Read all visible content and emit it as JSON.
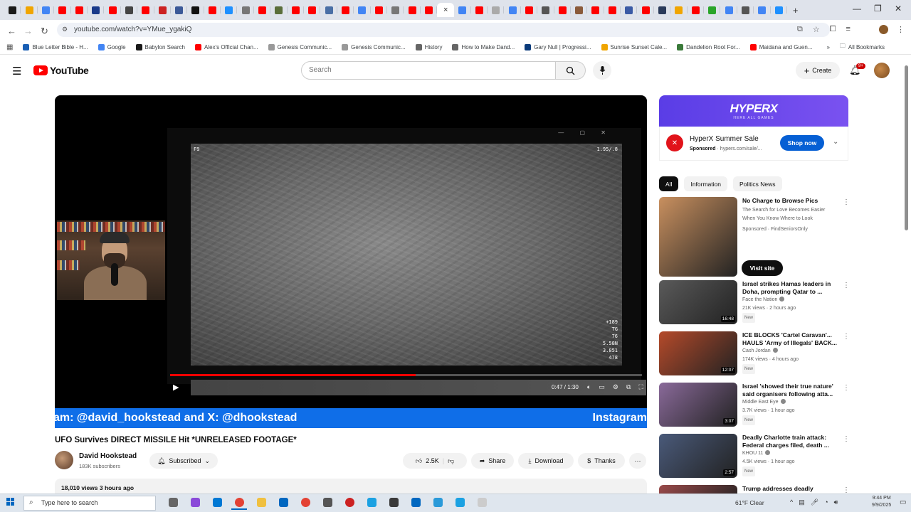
{
  "browser": {
    "tab_colors": [
      "#1a1a1a",
      "#f0a500",
      "#4285f4",
      "#ff0000",
      "#ff0000",
      "#1a3a8a",
      "#ff0000",
      "#444444",
      "#ff0000",
      "#cc2222",
      "#3b5998",
      "#111111",
      "#ff0000",
      "#1e90ff",
      "#777777",
      "#ff0000",
      "#5a6e3a",
      "#ff0000",
      "#ff0000",
      "#4a6fa5",
      "#ff0000",
      "#4285f4",
      "#ff0000",
      "#777777",
      "#ff0000",
      "#ff0000",
      "#ffffff",
      "#4285f4",
      "#ff0000",
      "#aaaaaa",
      "#4285f4",
      "#ff0000",
      "#555555",
      "#ff0000",
      "#8a5a3a",
      "#ff0000",
      "#ff0000",
      "#3a5aa5",
      "#ff0000",
      "#2a3a5a",
      "#f0a500",
      "#ff0000",
      "#2aa52a",
      "#4285f4",
      "#555555",
      "#4285f4",
      "#1e90ff"
    ],
    "new_tab": "+",
    "active_close": "×",
    "window_controls": {
      "minimize": "—",
      "restore": "❐",
      "close": "✕"
    },
    "url": "youtube.com/watch?v=YMue_ygakiQ",
    "bookmarks": [
      {
        "label": "Blue Letter Bible - H...",
        "color": "#1a5fb4"
      },
      {
        "label": "Google",
        "color": "#4285f4"
      },
      {
        "label": "Babylon Search",
        "color": "#1a1a1a"
      },
      {
        "label": "Alex's Official Chan...",
        "color": "#ff0000"
      },
      {
        "label": "Genesis Communic...",
        "color": "#999999"
      },
      {
        "label": "Genesis Communic...",
        "color": "#999999"
      },
      {
        "label": "History",
        "color": "#666666"
      },
      {
        "label": "How to Make Dand...",
        "color": "#666666"
      },
      {
        "label": "Gary Null | Progressi...",
        "color": "#0a3a7a"
      },
      {
        "label": "Sunrise Sunset Cale...",
        "color": "#f0a500"
      },
      {
        "label": "Dandelion Root For...",
        "color": "#3a7a3a"
      },
      {
        "label": "Maidana and Guen...",
        "color": "#ff0000"
      }
    ],
    "all_bookmarks": "All Bookmarks"
  },
  "youtube": {
    "logo_text": "YouTube",
    "search_placeholder": "Search",
    "create_label": "Create",
    "notif_count": "9+"
  },
  "player": {
    "hud_top_left": "F9",
    "hud_top_right": "1.95/.8",
    "hud_bottom_right": [
      "+189",
      "TG",
      "76",
      "5.58N",
      "3.851",
      "478"
    ],
    "time": "0:47 / 1:30",
    "progress": 0.52,
    "banner_left": "am: @david_hookstead and X: @dhookstead",
    "banner_right": "Instagram"
  },
  "video": {
    "title": "UFO Survives DIRECT MISSILE Hit *UNRELEASED FOOTAGE*",
    "channel": "David Hookstead",
    "subscribers": "183K subscribers",
    "subscribe_label": "Subscribed",
    "likes": "2.5K",
    "share": "Share",
    "download": "Download",
    "thanks": "Thanks",
    "views": "18,010 views  3 hours ago"
  },
  "ad": {
    "banner_brand": "HYPERX",
    "banner_sub": "HERE ALL GAMES",
    "title": "HyperX Summer Sale",
    "sponsored": "Sponsored",
    "domain": "hypers.com/sale/...",
    "cta": "Shop now"
  },
  "chips": [
    "All",
    "Information",
    "Politics News"
  ],
  "recommendations": [
    {
      "title": "No Charge to Browse Pics",
      "line2": "The Search for Love Becomes Easier When You Know Where to Look",
      "meta": "Sponsored · FindSeniorsOnly",
      "cta": "Visit site",
      "duration": "",
      "thumb": "#c9905f"
    },
    {
      "title": "Israel strikes Hamas leaders in Doha, prompting Qatar to ...",
      "channel": "Face the Nation",
      "views": "21K views · 2 hours ago",
      "new": "New",
      "duration": "16:48",
      "thumb": "#5a5a5a"
    },
    {
      "title": "ICE BLOCKS 'Cartel Caravan'... HAULS 'Army of Illegals' BACK...",
      "channel": "Cash Jordan",
      "views": "174K views · 4 hours ago",
      "new": "New",
      "duration": "12:07",
      "thumb": "#b54a2a"
    },
    {
      "title": "Israel 'showed their true nature' said organisers following atta...",
      "channel": "Middle East Eye",
      "views": "3.7K views · 1 hour ago",
      "new": "New",
      "duration": "3:07",
      "thumb": "#8a6a9a"
    },
    {
      "title": "Deadly Charlotte train attack: Federal charges filed, death ...",
      "channel": "KHOU 11",
      "views": "4.5K views · 1 hour ago",
      "new": "New",
      "duration": "2:57",
      "thumb": "#4a5a7a"
    },
    {
      "title": "Trump addresses deadly",
      "channel": "",
      "views": "",
      "new": "",
      "duration": "",
      "thumb": "#9a4a4a"
    }
  ],
  "taskbar": {
    "search_placeholder": "Type here to search",
    "apps": [
      "#666666",
      "#8a4ad9",
      "#0078d4",
      "#e34234",
      "#f0c040",
      "#0067c0",
      "#e34234",
      "#555555",
      "#cc2222",
      "#1ba1e2",
      "#3a3a3a",
      "#0067c0",
      "#2a9ad9",
      "#1ba1e2",
      "#cccccc"
    ],
    "weather": "61°F  Clear",
    "time": "9:44 PM",
    "date": "9/9/2025"
  }
}
